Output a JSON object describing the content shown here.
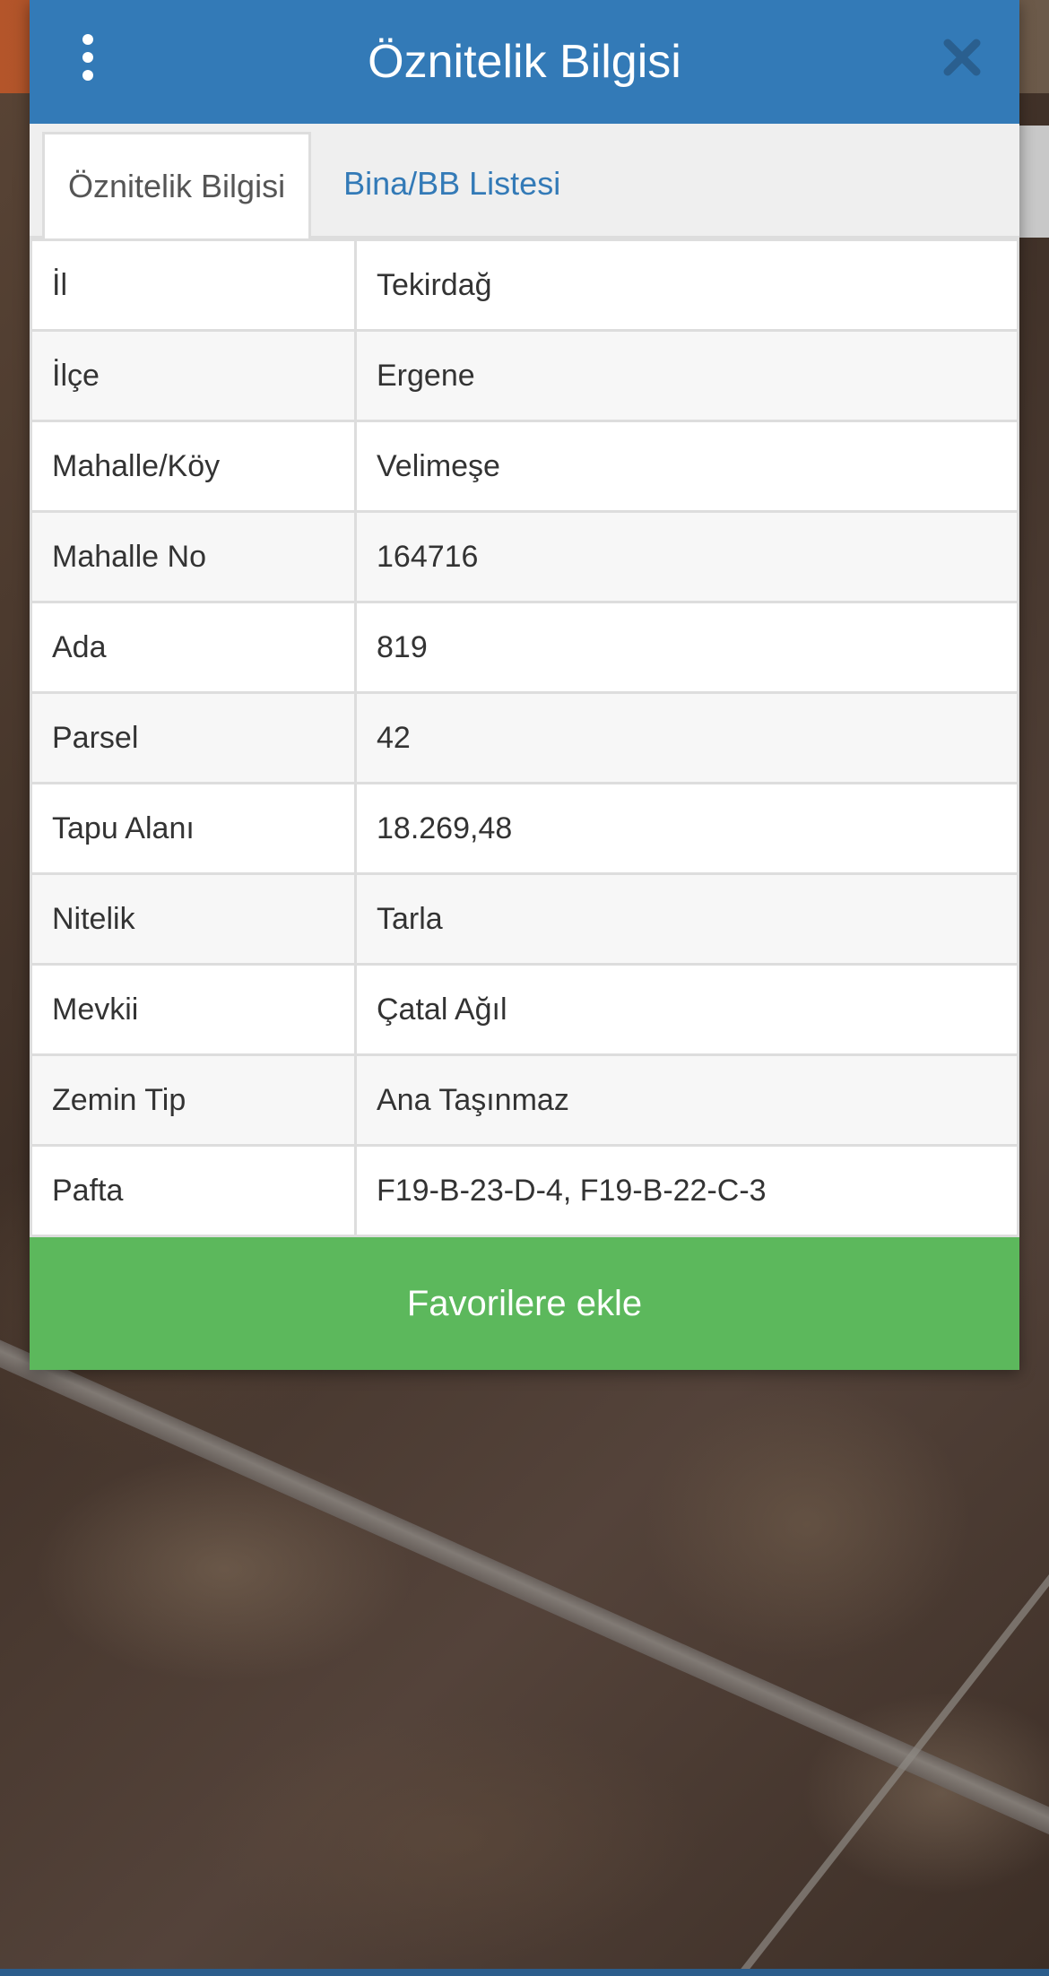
{
  "dialog": {
    "title": "Öznitelik Bilgisi",
    "menu_icon": "more-vertical-icon",
    "close_icon": "close-icon"
  },
  "tabs": [
    {
      "label": "Öznitelik Bilgisi",
      "active": true
    },
    {
      "label": "Bina/BB Listesi",
      "active": false
    }
  ],
  "attributes": [
    {
      "key": "İl",
      "value": "Tekirdağ"
    },
    {
      "key": "İlçe",
      "value": "Ergene"
    },
    {
      "key": "Mahalle/Köy",
      "value": "Velimeşe"
    },
    {
      "key": "Mahalle No",
      "value": "164716"
    },
    {
      "key": "Ada",
      "value": "819"
    },
    {
      "key": "Parsel",
      "value": "42"
    },
    {
      "key": "Tapu Alanı",
      "value": "18.269,48"
    },
    {
      "key": "Nitelik",
      "value": "Tarla"
    },
    {
      "key": "Mevkii",
      "value": "Çatal Ağıl"
    },
    {
      "key": "Zemin Tip",
      "value": "Ana Taşınmaz"
    },
    {
      "key": "Pafta",
      "value": "F19-B-23-D-4, F19-B-22-C-3"
    }
  ],
  "favorite_button": {
    "label": "Favorilere ekle"
  },
  "colors": {
    "header": "#337ab7",
    "favorite": "#5cb85c",
    "tab_link": "#337ab7"
  }
}
